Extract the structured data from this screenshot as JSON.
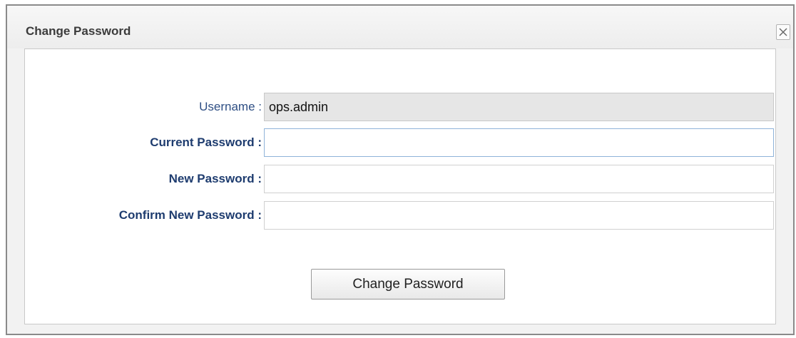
{
  "dialog": {
    "title": "Change Password",
    "close_icon": "close-x-icon"
  },
  "form": {
    "username": {
      "label": "Username :",
      "value": "ops.admin"
    },
    "current_password": {
      "label": "Current Password :",
      "value": ""
    },
    "new_password": {
      "label": "New Password :",
      "value": ""
    },
    "confirm_password": {
      "label": "Confirm New Password :",
      "value": ""
    },
    "submit_label": "Change Password"
  }
}
